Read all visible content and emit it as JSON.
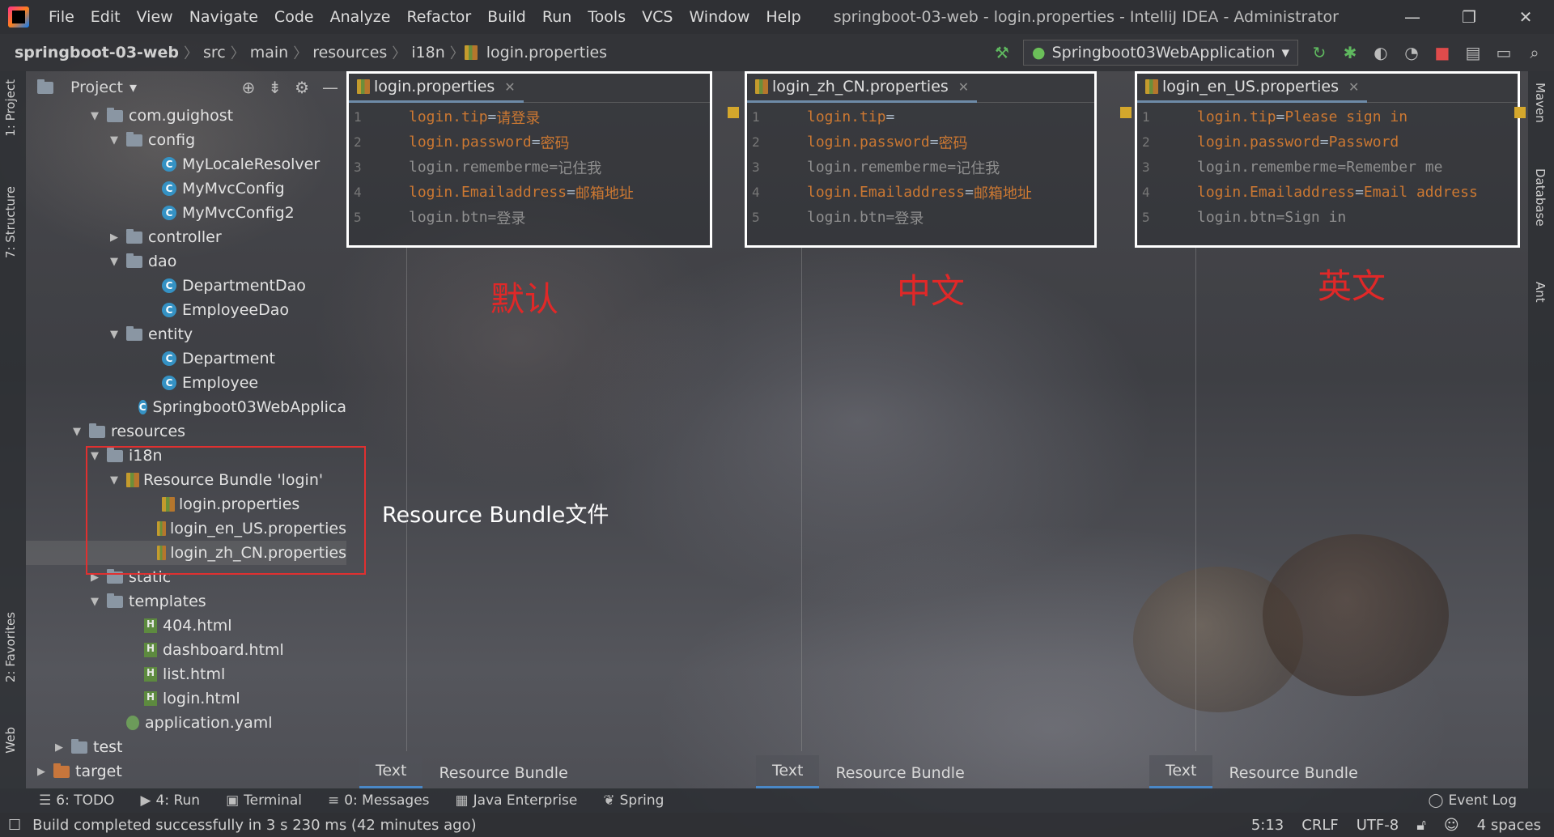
{
  "menubar": {
    "items": [
      "File",
      "Edit",
      "View",
      "Navigate",
      "Code",
      "Analyze",
      "Refactor",
      "Build",
      "Run",
      "Tools",
      "VCS",
      "Window",
      "Help"
    ],
    "title": "springboot-03-web - login.properties - IntelliJ IDEA - Administrator"
  },
  "navbar": {
    "crumbs": [
      "springboot-03-web",
      "src",
      "main",
      "resources",
      "i18n",
      "login.properties"
    ],
    "run_config": "Springboot03WebApplication"
  },
  "left_strip": {
    "project_tab": "1: Project",
    "structure_tab": "7: Structure",
    "favorites_tab": "2: Favorites",
    "web_tab": "Web"
  },
  "right_strip": {
    "maven_tab": "Maven",
    "database_tab": "Database",
    "ant_tab": "Ant"
  },
  "project": {
    "header": "Project",
    "tree": [
      {
        "label": "com.guighost",
        "icon": "folder",
        "arrow": "▼"
      },
      {
        "label": "config",
        "icon": "folder",
        "arrow": "▼"
      },
      {
        "label": "MyLocaleResolver",
        "icon": "class",
        "arrow": ""
      },
      {
        "label": "MyMvcConfig",
        "icon": "class",
        "arrow": ""
      },
      {
        "label": "MyMvcConfig2",
        "icon": "class",
        "arrow": ""
      },
      {
        "label": "controller",
        "icon": "folder",
        "arrow": "▶"
      },
      {
        "label": "dao",
        "icon": "folder",
        "arrow": "▼"
      },
      {
        "label": "DepartmentDao",
        "icon": "class",
        "arrow": ""
      },
      {
        "label": "EmployeeDao",
        "icon": "class",
        "arrow": ""
      },
      {
        "label": "entity",
        "icon": "folder",
        "arrow": "▼"
      },
      {
        "label": "Department",
        "icon": "class",
        "arrow": ""
      },
      {
        "label": "Employee",
        "icon": "class",
        "arrow": ""
      },
      {
        "label": "Springboot03WebApplica",
        "icon": "class",
        "arrow": ""
      },
      {
        "label": "resources",
        "icon": "folder",
        "arrow": "▼"
      },
      {
        "label": "i18n",
        "icon": "folder",
        "arrow": "▼"
      },
      {
        "label": "Resource Bundle 'login'",
        "icon": "bundle",
        "arrow": "▼"
      },
      {
        "label": "login.properties",
        "icon": "props",
        "arrow": ""
      },
      {
        "label": "login_en_US.properties",
        "icon": "props",
        "arrow": ""
      },
      {
        "label": "login_zh_CN.properties",
        "icon": "props",
        "arrow": ""
      },
      {
        "label": "static",
        "icon": "folder",
        "arrow": "▶"
      },
      {
        "label": "templates",
        "icon": "folder",
        "arrow": "▼"
      },
      {
        "label": "404.html",
        "icon": "html",
        "arrow": ""
      },
      {
        "label": "dashboard.html",
        "icon": "html",
        "arrow": ""
      },
      {
        "label": "list.html",
        "icon": "html",
        "arrow": ""
      },
      {
        "label": "login.html",
        "icon": "html",
        "arrow": ""
      },
      {
        "label": "application.yaml",
        "icon": "yaml",
        "arrow": ""
      },
      {
        "label": "test",
        "icon": "folder",
        "arrow": "▶"
      },
      {
        "label": "target",
        "icon": "folder-orange",
        "arrow": "▶"
      }
    ]
  },
  "annotation": {
    "resource_bundle": "Resource Bundle文件"
  },
  "editors": [
    {
      "tab": "login.properties",
      "label": "默认",
      "lines": [
        {
          "n": "1",
          "key": "login.tip",
          "value": "请登录",
          "dim": false
        },
        {
          "n": "2",
          "key": "login.password",
          "value": "密码",
          "dim": false
        },
        {
          "n": "3",
          "key": "login.rememberme",
          "value": "记住我",
          "dim": true
        },
        {
          "n": "4",
          "key": "login.Emailaddress",
          "value": "邮箱地址",
          "dim": false
        },
        {
          "n": "5",
          "key": "login.btn",
          "value": "登录",
          "dim": true
        }
      ],
      "bottom_tabs": [
        "Text",
        "Resource Bundle"
      ]
    },
    {
      "tab": "login_zh_CN.properties",
      "label": "中文",
      "lines": [
        {
          "n": "1",
          "key": "login.tip",
          "value": "",
          "dim": false
        },
        {
          "n": "2",
          "key": "login.password",
          "value": "密码",
          "dim": false
        },
        {
          "n": "3",
          "key": "login.rememberme",
          "value": "记住我",
          "dim": true
        },
        {
          "n": "4",
          "key": "login.Emailaddress",
          "value": "邮箱地址",
          "dim": false
        },
        {
          "n": "5",
          "key": "login.btn",
          "value": "登录",
          "dim": true
        }
      ],
      "bottom_tabs": [
        "Text",
        "Resource Bundle"
      ]
    },
    {
      "tab": "login_en_US.properties",
      "label": "英文",
      "lines": [
        {
          "n": "1",
          "key": "login.tip",
          "value": "Please sign in",
          "dim": false
        },
        {
          "n": "2",
          "key": "login.password",
          "value": "Password",
          "dim": false
        },
        {
          "n": "3",
          "key": "login.rememberme",
          "value": "Remember me",
          "dim": true
        },
        {
          "n": "4",
          "key": "login.Emailaddress",
          "value": "Email address",
          "dim": false
        },
        {
          "n": "5",
          "key": "login.btn",
          "value": "Sign in",
          "dim": true
        }
      ],
      "bottom_tabs": [
        "Text",
        "Resource Bundle"
      ]
    }
  ],
  "toolwindows": [
    "6: TODO",
    "4: Run",
    "Terminal",
    "0: Messages",
    "Java Enterprise",
    "Spring"
  ],
  "event_log": "Event Log",
  "status": {
    "message": "Build completed successfully in 3 s 230 ms (42 minutes ago)",
    "position": "5:13",
    "line_sep": "CRLF",
    "encoding": "UTF-8",
    "indent": "4 spaces"
  },
  "colors": {
    "key": "#cc7832",
    "highlight_box": "#ffffff",
    "annotation_red": "#e02828"
  }
}
